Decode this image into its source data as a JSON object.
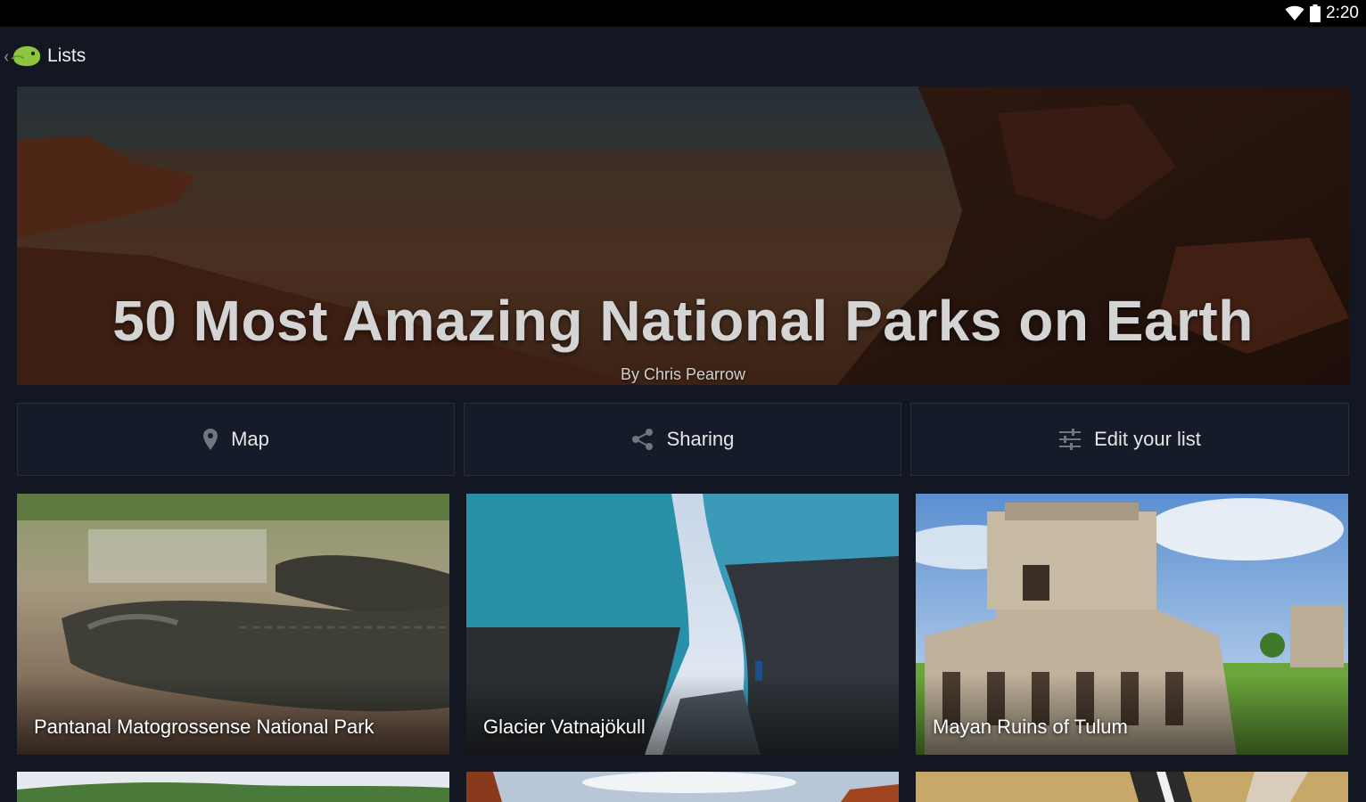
{
  "status_bar": {
    "time": "2:20"
  },
  "action_bar": {
    "title": "Lists"
  },
  "hero": {
    "title": "50 Most Amazing National Parks on Earth",
    "author": "By Chris Pearrow"
  },
  "actions": {
    "map_label": "Map",
    "sharing_label": "Sharing",
    "edit_label": "Edit your list"
  },
  "cards": [
    {
      "label": "Pantanal Matogrossense National Park"
    },
    {
      "label": "Glacier Vatnajökull"
    },
    {
      "label": "Mayan Ruins of Tulum"
    }
  ],
  "colors": {
    "background": "#121722",
    "button_bg": "#151b28",
    "logo_green": "#8cc63f"
  },
  "icons": {
    "wifi": "wifi-icon",
    "battery": "battery-icon",
    "back": "chevron-left-icon",
    "logo": "app-logo-icon",
    "map": "map-pin-icon",
    "share": "share-icon",
    "edit": "sliders-icon"
  }
}
